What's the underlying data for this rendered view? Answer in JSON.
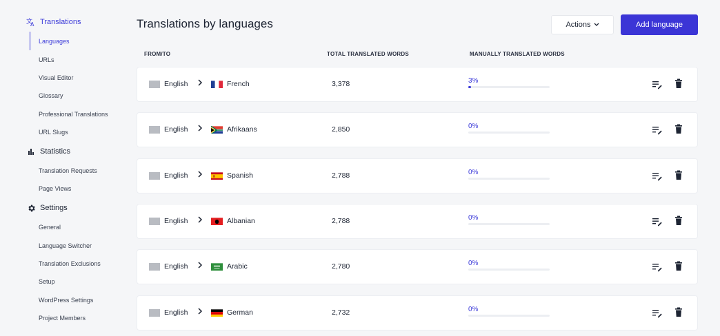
{
  "sidebar": {
    "translations": {
      "label": "Translations",
      "items": [
        "Languages",
        "URLs",
        "Visual Editor",
        "Glossary",
        "Professional Translations",
        "URL Slugs"
      ]
    },
    "statistics": {
      "label": "Statistics",
      "items": [
        "Translation Requests",
        "Page Views"
      ]
    },
    "settings": {
      "label": "Settings",
      "items": [
        "General",
        "Language Switcher",
        "Translation Exclusions",
        "Setup",
        "WordPress Settings",
        "Project Members"
      ]
    }
  },
  "header": {
    "title": "Translations by languages",
    "actions_label": "Actions",
    "add_label": "Add language"
  },
  "columns": {
    "from_to": "FROM/TO",
    "total": "TOTAL TRANSLATED WORDS",
    "manual": "MANUALLY TRANSLATED WORDS"
  },
  "rows": [
    {
      "from": "English",
      "to": "French",
      "flag": "fr",
      "words": "3,378",
      "pct": "3%",
      "progress": 0.03
    },
    {
      "from": "English",
      "to": "Afrikaans",
      "flag": "za",
      "words": "2,850",
      "pct": "0%",
      "progress": 0
    },
    {
      "from": "English",
      "to": "Spanish",
      "flag": "es",
      "words": "2,788",
      "pct": "0%",
      "progress": 0
    },
    {
      "from": "English",
      "to": "Albanian",
      "flag": "al",
      "words": "2,788",
      "pct": "0%",
      "progress": 0
    },
    {
      "from": "English",
      "to": "Arabic",
      "flag": "sa",
      "words": "2,780",
      "pct": "0%",
      "progress": 0
    },
    {
      "from": "English",
      "to": "German",
      "flag": "de",
      "words": "2,732",
      "pct": "0%",
      "progress": 0
    }
  ],
  "colors": {
    "accent": "#3c3bd9",
    "button": "#3b35d6"
  }
}
